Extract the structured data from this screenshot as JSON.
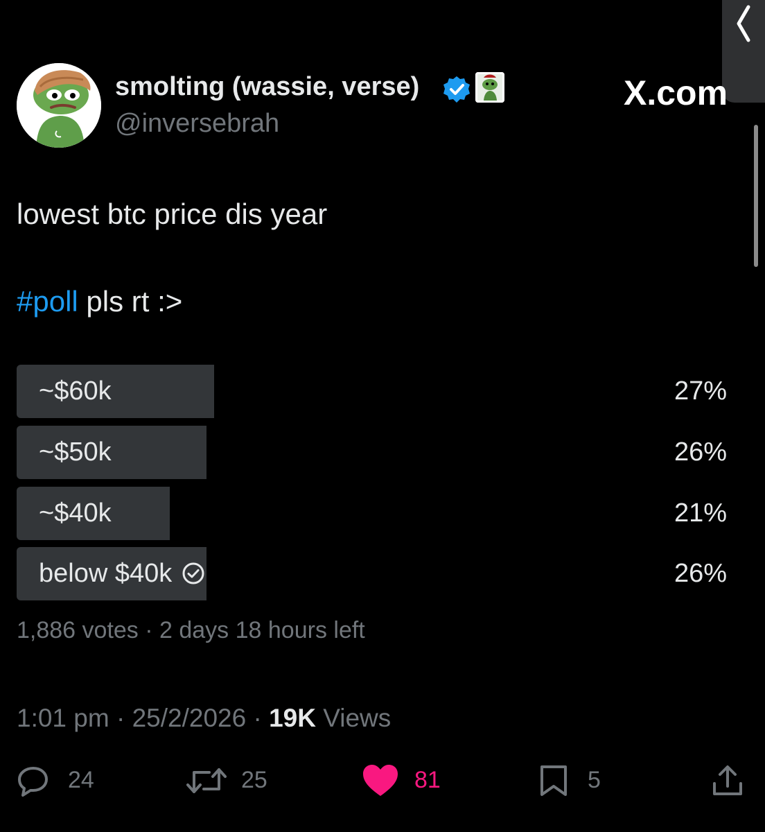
{
  "brand": {
    "watermark": "X.com"
  },
  "author": {
    "display_name": "smolting (wassie, verse)",
    "handle": "@inversebrah"
  },
  "tweet": {
    "line1": "lowest btc price dis year",
    "hashtag": "#poll",
    "line2_rest": " pls rt :>"
  },
  "poll": {
    "options": [
      {
        "label": "~$60k",
        "percent_text": "27%",
        "percent": 27,
        "selected": false
      },
      {
        "label": "~$50k",
        "percent_text": "26%",
        "percent": 26,
        "selected": false
      },
      {
        "label": "~$40k",
        "percent_text": "21%",
        "percent": 21,
        "selected": false
      },
      {
        "label": "below $40k",
        "percent_text": "26%",
        "percent": 26,
        "selected": true
      }
    ],
    "meta": "1,886 votes · 2 days 18 hours left"
  },
  "timestamp": {
    "time_date": "1:01 pm · 25/2/2026 · ",
    "views_count": "19K",
    "views_label": " Views"
  },
  "actions": {
    "replies": "24",
    "reposts": "25",
    "likes": "81",
    "bookmarks": "5"
  },
  "colors": {
    "background": "#000000",
    "text": "#e7e9ea",
    "muted": "#71767b",
    "hashtag": "#1d9bf0",
    "poll_fill": "#333639",
    "like_active": "#f91880",
    "verified": "#1d9bf0"
  },
  "icons": {
    "verified": "verified-badge-icon",
    "poll_selected": "check-circle-icon",
    "reply": "reply-icon",
    "repost": "repost-icon",
    "like": "heart-filled-icon",
    "bookmark": "bookmark-icon",
    "share": "share-icon",
    "back": "chevron-left-icon"
  }
}
